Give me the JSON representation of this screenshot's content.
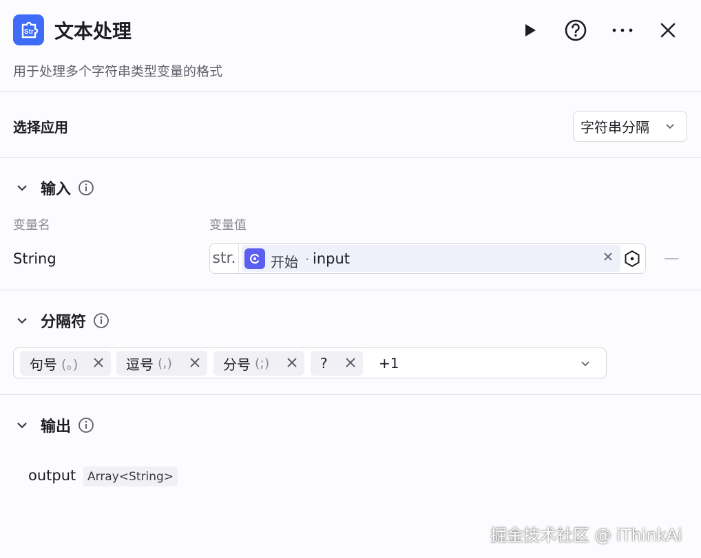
{
  "header": {
    "app_icon": "puzzle-str-icon",
    "title": "文本处理",
    "subtitle": "用于处理多个字符串类型变量的格式",
    "buttons": [
      "play-icon",
      "help-icon",
      "more-icon",
      "close-icon"
    ]
  },
  "select_app": {
    "label": "选择应用",
    "value": "字符串分隔"
  },
  "input_section": {
    "title": "输入",
    "col_name": "变量名",
    "col_value": "变量值",
    "row": {
      "name": "String",
      "type_tag": "str.",
      "ref_node": "开始",
      "ref_sep": "·",
      "ref_var": "input"
    }
  },
  "separator_section": {
    "title": "分隔符",
    "tags": [
      {
        "label": "句号",
        "symbol": "(。)"
      },
      {
        "label": "逗号",
        "symbol": "(,)"
      },
      {
        "label": "分号",
        "symbol": "(;)"
      },
      {
        "label": "?",
        "symbol": ""
      }
    ],
    "more": "+1"
  },
  "output_section": {
    "title": "输出",
    "name": "output",
    "type": "Array<String>"
  },
  "watermark": "掘金技术社区 @ iThinkAi",
  "colors": {
    "accent": "#3f6cf6",
    "ref_icon": "#5b5ef0",
    "border": "#d6d6de",
    "muted_text": "#8b8b96"
  }
}
